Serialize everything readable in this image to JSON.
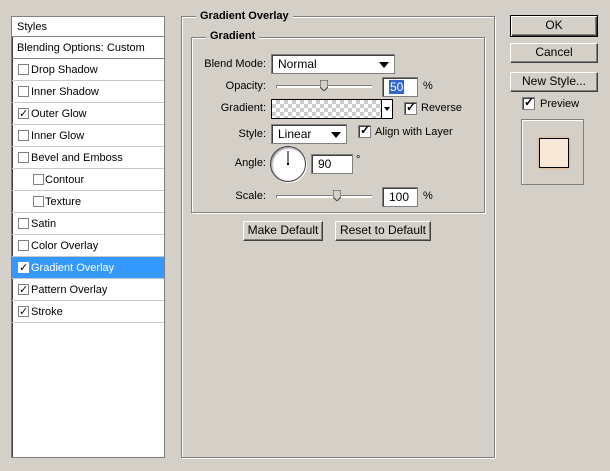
{
  "styles_panel": {
    "header": "Styles",
    "blending_options": "Blending Options: Custom",
    "items": [
      {
        "label": "Drop Shadow",
        "checked": false,
        "sub": false,
        "selected": false
      },
      {
        "label": "Inner Shadow",
        "checked": false,
        "sub": false,
        "selected": false
      },
      {
        "label": "Outer Glow",
        "checked": true,
        "sub": false,
        "selected": false
      },
      {
        "label": "Inner Glow",
        "checked": false,
        "sub": false,
        "selected": false
      },
      {
        "label": "Bevel and Emboss",
        "checked": false,
        "sub": false,
        "selected": false
      },
      {
        "label": "Contour",
        "checked": false,
        "sub": true,
        "selected": false
      },
      {
        "label": "Texture",
        "checked": false,
        "sub": true,
        "selected": false
      },
      {
        "label": "Satin",
        "checked": false,
        "sub": false,
        "selected": false
      },
      {
        "label": "Color Overlay",
        "checked": false,
        "sub": false,
        "selected": false
      },
      {
        "label": "Gradient Overlay",
        "checked": true,
        "sub": false,
        "selected": true
      },
      {
        "label": "Pattern Overlay",
        "checked": true,
        "sub": false,
        "selected": false
      },
      {
        "label": "Stroke",
        "checked": true,
        "sub": false,
        "selected": false
      }
    ]
  },
  "gradient_overlay": {
    "section_title": "Gradient Overlay",
    "group_title": "Gradient",
    "blend_mode_label": "Blend Mode:",
    "blend_mode_value": "Normal",
    "opacity_label": "Opacity:",
    "opacity_value": "50",
    "opacity_unit": "%",
    "opacity_fraction": 0.5,
    "gradient_label": "Gradient:",
    "reverse_label": "Reverse",
    "reverse_checked": true,
    "style_label": "Style:",
    "style_value": "Linear",
    "align_label": "Align with Layer",
    "align_checked": true,
    "angle_label": "Angle:",
    "angle_value": "90",
    "angle_unit": "°",
    "scale_label": "Scale:",
    "scale_value": "100",
    "scale_unit": "%",
    "scale_fraction": 0.64,
    "make_default": "Make Default",
    "reset_default": "Reset to Default"
  },
  "buttons": {
    "ok": "OK",
    "cancel": "Cancel",
    "new_style": "New Style...",
    "preview_label": "Preview",
    "preview_checked": true
  },
  "colors": {
    "selection": "#3399ff",
    "preview_swatch": "#f8e8d8",
    "dialog_bg": "#d4d0c8"
  }
}
